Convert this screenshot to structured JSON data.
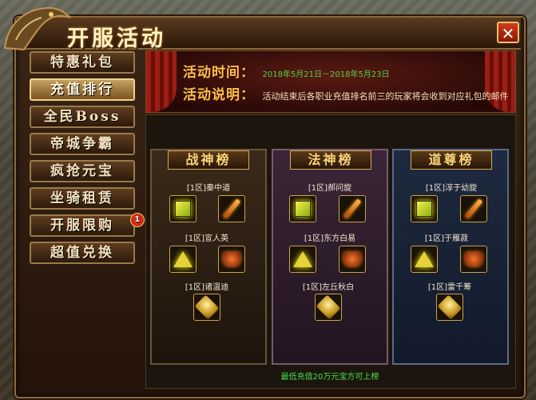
{
  "window": {
    "title": "开服活动",
    "close_label": "✕"
  },
  "sidebar": {
    "items": [
      {
        "label": "特惠礼包"
      },
      {
        "label": "充值排行",
        "active": true
      },
      {
        "label": "全民Boss"
      },
      {
        "label": "帝城争霸"
      },
      {
        "label": "疯抢元宝"
      },
      {
        "label": "坐骑租赁"
      },
      {
        "label": "开服限购",
        "badge": "1"
      },
      {
        "label": "超值兑换"
      }
    ]
  },
  "banner": {
    "time_label": "活动时间：",
    "time_value": "2018年5月21日－2018年5月23日",
    "desc_label": "活动说明：",
    "desc_value": "活动结束后各职业充值排名前三的玩家将会收到对应礼包的邮件"
  },
  "panels": [
    {
      "title": "战神榜",
      "ranks": [
        "[1区]秦中道",
        "[1区]宣人英",
        "[1区]诸温迪"
      ]
    },
    {
      "title": "法神榜",
      "ranks": [
        "[1区]郝问旋",
        "[1区]东方白易",
        "[1区]左丘秋白"
      ]
    },
    {
      "title": "道尊榜",
      "ranks": [
        "[1区]淳于幼旋",
        "[1区]于雁菽",
        "[1区]雷千筹"
      ]
    }
  ],
  "footer": {
    "note": "最低充值20万元宝方可上榜"
  },
  "colors": {
    "accent": "#f6c24a",
    "green_text": "#45e04a",
    "date_green": "#4fd24a"
  }
}
